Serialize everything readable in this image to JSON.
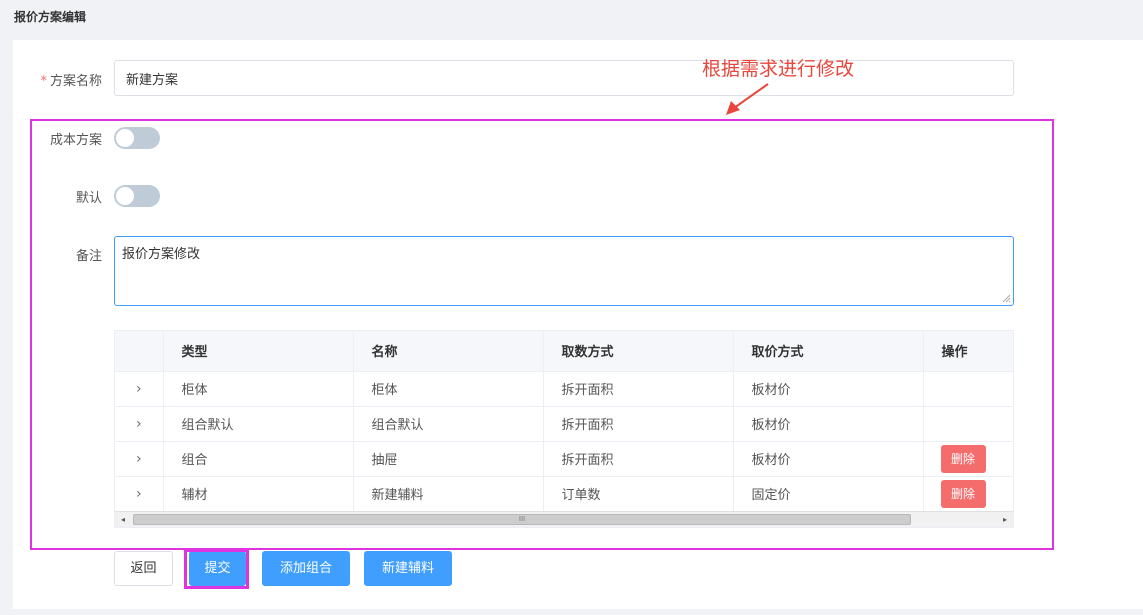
{
  "page": {
    "title": "报价方案编辑"
  },
  "form": {
    "name": {
      "label": "方案名称",
      "required_mark": "*",
      "value": "新建方案"
    },
    "cost_plan": {
      "label": "成本方案",
      "on": false
    },
    "default": {
      "label": "默认",
      "on": false
    },
    "remark": {
      "label": "备注",
      "value": "报价方案修改"
    }
  },
  "table": {
    "columns": [
      "",
      "类型",
      "名称",
      "取数方式",
      "取价方式",
      "操作"
    ],
    "rows": [
      {
        "expand": "›",
        "type": "柜体",
        "name": "柜体",
        "fetch_method": "拆开面积",
        "price_method": "板材价",
        "action": ""
      },
      {
        "expand": "›",
        "type": "组合默认",
        "name": "组合默认",
        "fetch_method": "拆开面积",
        "price_method": "板材价",
        "action": ""
      },
      {
        "expand": "›",
        "type": "组合",
        "name": "抽屉",
        "fetch_method": "拆开面积",
        "price_method": "板材价",
        "action": "删除"
      },
      {
        "expand": "›",
        "type": "辅材",
        "name": "新建辅料",
        "fetch_method": "订单数",
        "price_method": "固定价",
        "action": "删除"
      }
    ],
    "scroll": {
      "left_arrow": "◂",
      "right_arrow": "▸",
      "thumb_grip": "III"
    }
  },
  "buttons": {
    "back": "返回",
    "submit": "提交",
    "add_group": "添加组合",
    "new_material": "新建辅料"
  },
  "annotation": {
    "text": "根据需求进行修改",
    "color": "#e8473d",
    "frame_color": "#e033e0"
  },
  "colors": {
    "primary": "#409eff",
    "danger": "#f56c6c",
    "switch_off": "#c0cbd8"
  }
}
